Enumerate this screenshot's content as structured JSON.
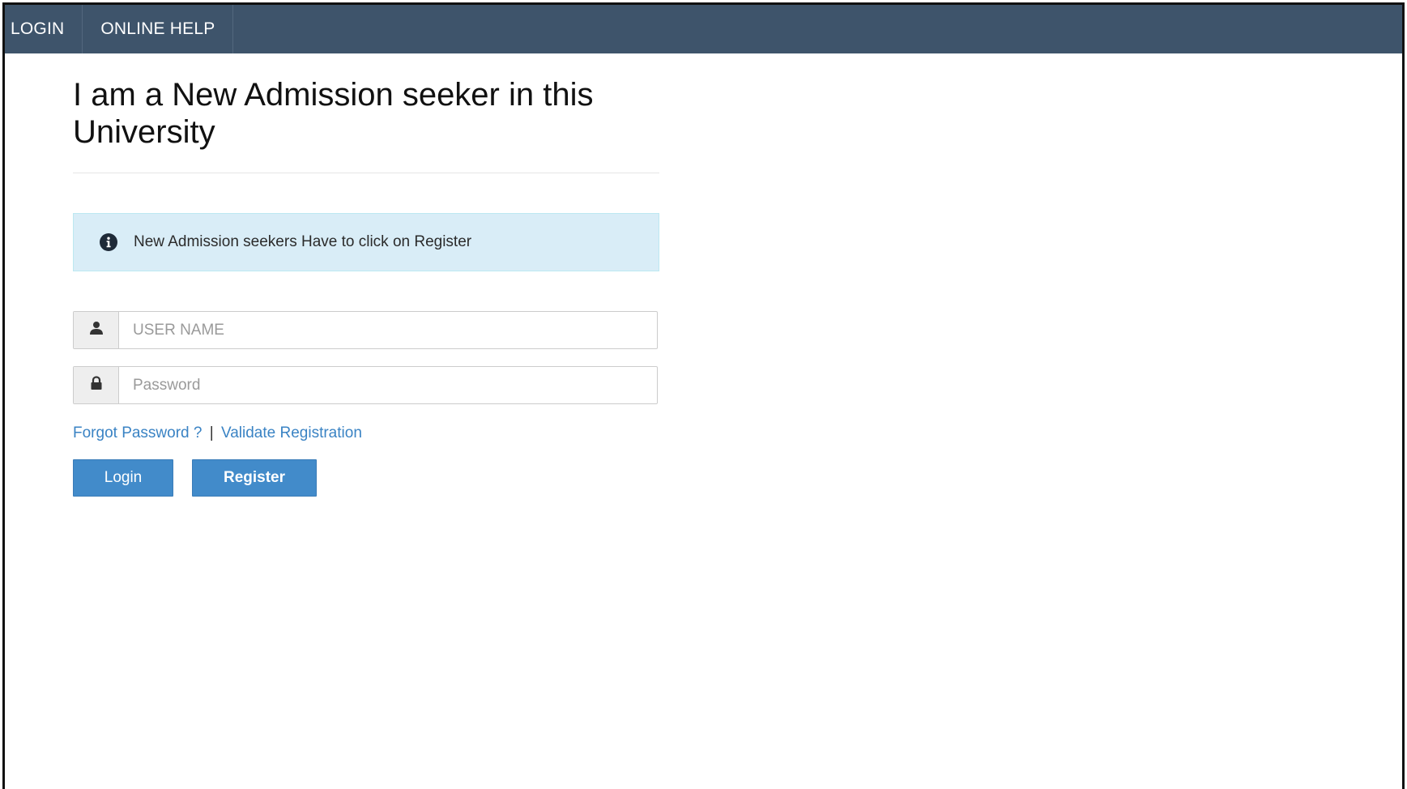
{
  "nav": {
    "items": [
      {
        "label": "LOGIN"
      },
      {
        "label": "ONLINE HELP"
      }
    ]
  },
  "main": {
    "heading": "I am a New Admission seeker in this University",
    "alert": {
      "icon": "info-circle-icon",
      "text": "New Admission seekers Have to click on Register"
    },
    "username": {
      "icon": "user-icon",
      "placeholder": "USER NAME",
      "value": ""
    },
    "password": {
      "icon": "lock-icon",
      "placeholder": "Password",
      "value": ""
    },
    "links": {
      "forgot": "Forgot Password ?",
      "separator": "|",
      "validate": "Validate Registration"
    },
    "buttons": {
      "login": "Login",
      "register": "Register"
    }
  },
  "colors": {
    "navbar": "#3e546b",
    "primary_button": "#428bca",
    "alert_bg": "#d9edf7",
    "link": "#3a83c4"
  }
}
